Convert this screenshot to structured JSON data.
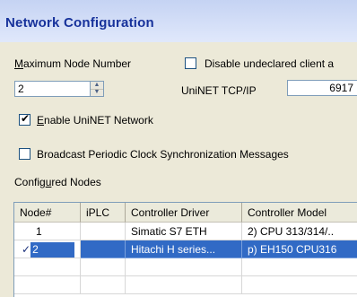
{
  "window": {
    "title": "Network Configuration"
  },
  "max_node": {
    "label_prefix": "M",
    "label_rest": "aximum Node Number",
    "value": "2"
  },
  "disable_undeclared": {
    "label": "Disable undeclared client a",
    "checked": false
  },
  "uninet": {
    "label": "UniNET TCP/IP",
    "value": "6917"
  },
  "enable_uninet": {
    "label_prefix": "E",
    "label_rest": "nable UniNET Network",
    "checked": true
  },
  "broadcast_sync": {
    "label": "Broadcast Periodic Clock Synchronization Messages",
    "checked": false
  },
  "nodes_group": {
    "label_before": "Config",
    "label_underlined": "u",
    "label_after": "red Nodes"
  },
  "table": {
    "columns": [
      "Node#",
      "iPLC",
      "Controller Driver",
      "Controller Model"
    ],
    "rows": [
      {
        "check": "",
        "node": "1",
        "iplc": "",
        "driver": "Simatic S7 ETH",
        "model": "2) CPU 313/314/..",
        "selected": false
      },
      {
        "check": "✓",
        "node": "2",
        "iplc": "",
        "driver": "Hitachi H series...",
        "model": "p) EH150 CPU316",
        "selected": true
      }
    ]
  }
}
